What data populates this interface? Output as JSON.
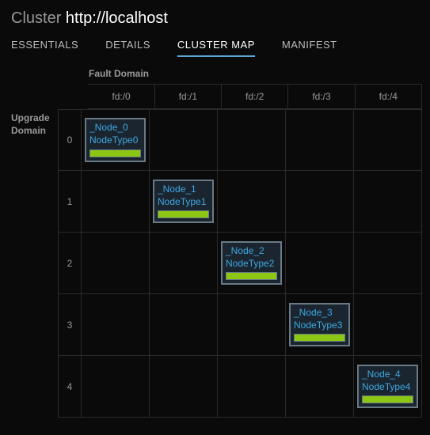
{
  "header": {
    "title": "Cluster",
    "url": "http://localhost"
  },
  "tabs": [
    {
      "label": "ESSENTIALS",
      "active": false
    },
    {
      "label": "DETAILS",
      "active": false
    },
    {
      "label": "CLUSTER MAP",
      "active": true
    },
    {
      "label": "MANIFEST",
      "active": false
    }
  ],
  "grid": {
    "fault_domain_label": "Fault Domain",
    "upgrade_domain_label": "Upgrade Domain",
    "columns": [
      "fd:/0",
      "fd:/1",
      "fd:/2",
      "fd:/3",
      "fd:/4"
    ],
    "rows": [
      "0",
      "1",
      "2",
      "3",
      "4"
    ],
    "nodes": [
      {
        "row": 0,
        "col": 0,
        "name": "_Node_0",
        "type": "NodeType0",
        "status_color": "#8cc713"
      },
      {
        "row": 1,
        "col": 1,
        "name": "_Node_1",
        "type": "NodeType1",
        "status_color": "#8cc713"
      },
      {
        "row": 2,
        "col": 2,
        "name": "_Node_2",
        "type": "NodeType2",
        "status_color": "#8cc713"
      },
      {
        "row": 3,
        "col": 3,
        "name": "_Node_3",
        "type": "NodeType3",
        "status_color": "#8cc713"
      },
      {
        "row": 4,
        "col": 4,
        "name": "_Node_4",
        "type": "NodeType4",
        "status_color": "#8cc713"
      }
    ]
  }
}
